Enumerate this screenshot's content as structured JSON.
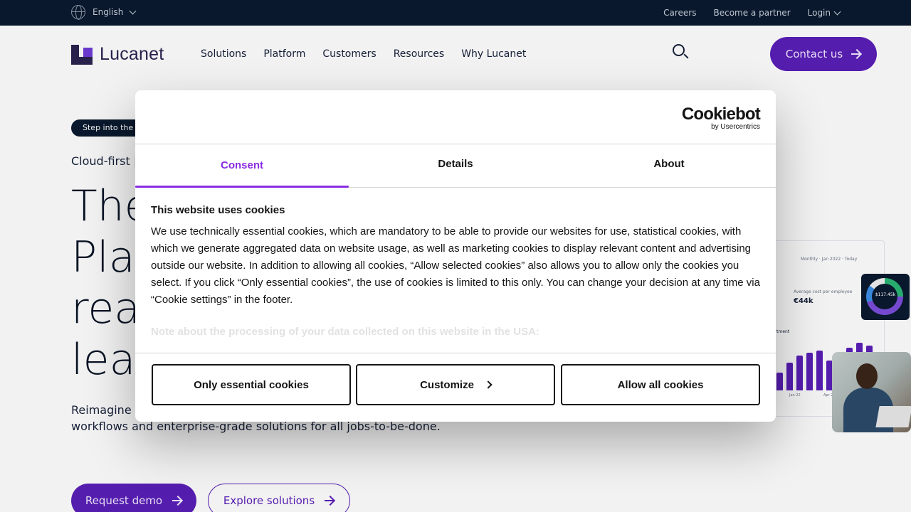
{
  "topbar": {
    "language": "English",
    "links": [
      "Careers",
      "Become a partner",
      "Login"
    ]
  },
  "header": {
    "brand": "Lucanet",
    "nav": [
      "Solutions",
      "Platform",
      "Customers",
      "Resources",
      "Why Lucanet"
    ],
    "contact_label": "Contact us"
  },
  "hero": {
    "pill": "Step into the",
    "eyebrow": "Cloud-first |",
    "headline": [
      "The",
      "Plat",
      "rea",
      "lea"
    ],
    "subtext_line1": "Reimagine",
    "subtext_line2": "workflows and enterprise-grade solutions for all jobs-to-be-done.",
    "cta_primary": "Request demo",
    "cta_secondary": "Explore solutions"
  },
  "dashboard": {
    "meta": "Monthly  ·  Jan 2022  ·  Today",
    "kpi_label": "Average cost per employee",
    "kpi_value": "€44k",
    "section": "artment",
    "x_labels": [
      "Jan 22",
      "Apr 22"
    ],
    "donut_value": "$117.45k",
    "bar_values": [
      0.35,
      0.55,
      0.7,
      0.75,
      0.8,
      0.6,
      0.65,
      0.85,
      0.95,
      0.9
    ],
    "colors": {
      "bar": "#5a1fb8"
    }
  },
  "cookie_dialog": {
    "logo_main": "Cookiebot",
    "logo_sub": "by Usercentrics",
    "tabs": [
      "Consent",
      "Details",
      "About"
    ],
    "active_tab": "Consent",
    "title": "This website uses cookies",
    "body": "We use technically essential cookies, which are mandatory to be able to provide our websites for use, statistical cookies, with which we generate aggregated data on website usage, as well as marketing cookies to display relevant content and advertising outside our website. In addition to allowing all cookies, “Allow selected cookies” also allows you to allow only the cookies you select. If you click “Only essential cookies”, the use of cookies is limited to this only. You can change your decision at any time via “Cookie settings” in the footer.",
    "note": "Note about the processing of your data collected on this website in the USA:",
    "buttons": {
      "essential": "Only essential cookies",
      "customize": "Customize",
      "allow_all": "Allow all cookies"
    },
    "accent": "#8a2be2"
  }
}
